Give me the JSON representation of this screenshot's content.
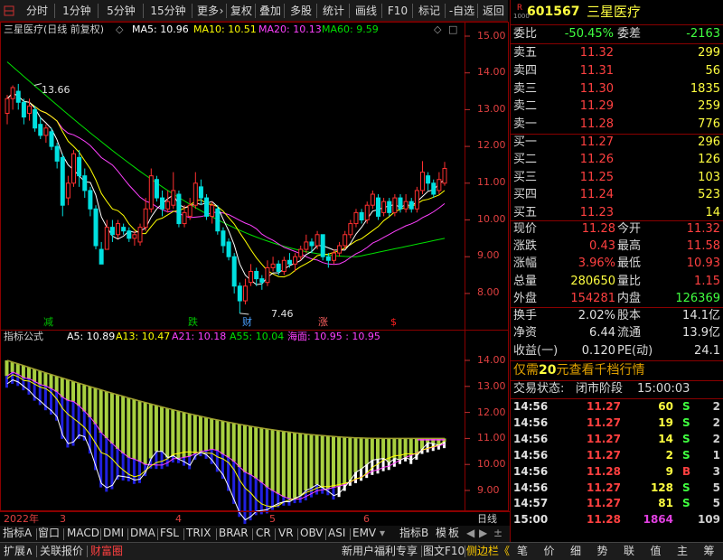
{
  "toolbar": {
    "items": [
      "分时",
      "1分钟",
      "5分钟",
      "15分钟",
      "更多",
      "复权",
      "叠加",
      "多股",
      "统计",
      "画线",
      "F10",
      "标记",
      "-自选",
      "返回"
    ],
    "more_arrow": "›"
  },
  "main_chart": {
    "title": "三星医疗(日线 前复权)",
    "ma_labels": [
      {
        "text": "MA5: 10.96",
        "color": "#ffffff"
      },
      {
        "text": "MA10: 10.51",
        "color": "#ffff00"
      },
      {
        "text": "MA20: 10.13",
        "color": "#ff40ff"
      },
      {
        "text": "MA60: 9.59",
        "color": "#00e000"
      }
    ],
    "y_ticks": [
      "15.00",
      "14.00",
      "13.00",
      "12.00",
      "11.00",
      "10.00",
      "9.00",
      "8.00"
    ],
    "high_label": "13.66",
    "low_label": "7.46",
    "markers": [
      {
        "text": "减",
        "color": "#00c000"
      },
      {
        "text": "跌",
        "color": "#00c000"
      },
      {
        "text": "财",
        "color": "#4aa0ff"
      },
      {
        "text": "涨",
        "color": "#ff6060"
      },
      {
        "text": "$",
        "color": "#ff2020"
      }
    ]
  },
  "sub_chart": {
    "name": "指标公式",
    "labels": [
      {
        "text": "A5: 10.89",
        "color": "#ffffff"
      },
      {
        "text": "A13: 10.47",
        "color": "#ffff00"
      },
      {
        "text": "A21: 10.18",
        "color": "#ff40ff"
      },
      {
        "text": "A55: 10.04",
        "color": "#00e000"
      },
      {
        "text": "海面: 10.95 : 10.95",
        "color": "#ff40ff"
      }
    ],
    "y_ticks": [
      "14.00",
      "13.00",
      "12.00",
      "11.00",
      "10.00",
      "9.00"
    ]
  },
  "time_axis": {
    "labels": [
      "2022年",
      "3",
      "4",
      "5",
      "6"
    ],
    "period": "日线"
  },
  "indicator_tabs": [
    "指标A",
    "窗口",
    "MACD",
    "DMI",
    "DMA",
    "FSL",
    "TRIX",
    "BRAR",
    "CR",
    "VR",
    "OBV",
    "ASI",
    "EMV",
    "指标B",
    "模",
    "板"
  ],
  "bottom_bar": {
    "items": [
      "扩展∧",
      "关联报价",
      "财富圈"
    ],
    "right_items": [
      "新用户福利专享",
      "图文F10",
      "侧边栏《"
    ],
    "right_tabs": [
      "笔",
      "价",
      "细",
      "势",
      "联",
      "值",
      "主",
      "筹"
    ]
  },
  "quote": {
    "code": "601567",
    "name": "三星医疗",
    "r_badge": "R",
    "wei_bi_label": "委比",
    "wei_bi": "-50.45%",
    "wei_cha_label": "委差",
    "wei_cha": "-2163",
    "asks": [
      {
        "label": "卖五",
        "price": "11.32",
        "vol": "299"
      },
      {
        "label": "卖四",
        "price": "11.31",
        "vol": "56"
      },
      {
        "label": "卖三",
        "price": "11.30",
        "vol": "1835"
      },
      {
        "label": "卖二",
        "price": "11.29",
        "vol": "259"
      },
      {
        "label": "卖一",
        "price": "11.28",
        "vol": "776"
      }
    ],
    "bids": [
      {
        "label": "买一",
        "price": "11.27",
        "vol": "296"
      },
      {
        "label": "买二",
        "price": "11.26",
        "vol": "126"
      },
      {
        "label": "买三",
        "price": "11.25",
        "vol": "103"
      },
      {
        "label": "买四",
        "price": "11.24",
        "vol": "523"
      },
      {
        "label": "买五",
        "price": "11.23",
        "vol": "14"
      }
    ],
    "stats": [
      {
        "l1": "现价",
        "v1": "11.28",
        "c1": "#ff4040",
        "l2": "今开",
        "v2": "11.32",
        "c2": "#ff4040"
      },
      {
        "l1": "涨跌",
        "v1": "0.43",
        "c1": "#ff4040",
        "l2": "最高",
        "v2": "11.58",
        "c2": "#ff4040"
      },
      {
        "l1": "涨幅",
        "v1": "3.96%",
        "c1": "#ff4040",
        "l2": "最低",
        "v2": "10.93",
        "c2": "#ff4040"
      },
      {
        "l1": "总量",
        "v1": "280650",
        "c1": "#ffff40",
        "l2": "量比",
        "v2": "1.15",
        "c2": "#ff4040"
      },
      {
        "l1": "外盘",
        "v1": "154281",
        "c1": "#ff4040",
        "l2": "内盘",
        "v2": "126369",
        "c2": "#40ff40"
      }
    ],
    "stats2": [
      {
        "l1": "换手",
        "v1": "2.02%",
        "l2": "股本",
        "v2": "14.1亿"
      },
      {
        "l1": "净资",
        "v1": "6.44",
        "l2": "流通",
        "v2": "13.9亿"
      },
      {
        "l1": "收益(一)",
        "v1": "0.120",
        "l2": "PE(动)",
        "v2": "24.1"
      }
    ],
    "promo_prefix": "仅需",
    "promo_num": "20",
    "promo_suffix": "元查看千档行情",
    "trade_status_label": "交易状态:",
    "trade_status": "闭市阶段",
    "trade_time": "15:00:03"
  },
  "trades": [
    {
      "time": "14:56",
      "price": "11.27",
      "vol": "60",
      "side": "S",
      "count": "2"
    },
    {
      "time": "14:56",
      "price": "11.27",
      "vol": "19",
      "side": "S",
      "count": "2"
    },
    {
      "time": "14:56",
      "price": "11.27",
      "vol": "14",
      "side": "S",
      "count": "2"
    },
    {
      "time": "14:56",
      "price": "11.27",
      "vol": "2",
      "side": "S",
      "count": "1"
    },
    {
      "time": "14:56",
      "price": "11.28",
      "vol": "9",
      "side": "B",
      "count": "3"
    },
    {
      "time": "14:56",
      "price": "11.27",
      "vol": "128",
      "side": "S",
      "count": "5"
    },
    {
      "time": "14:57",
      "price": "11.27",
      "vol": "81",
      "side": "S",
      "count": "5"
    },
    {
      "time": "15:00",
      "price": "11.28",
      "vol": "1864",
      "side": "",
      "count": "109"
    }
  ],
  "colors": {
    "up": "#ff3030",
    "down": "#00e0e0",
    "ma5": "#ffffff",
    "ma10": "#ffff00",
    "ma20": "#ff40ff",
    "ma60": "#00e000"
  },
  "candles": [
    [
      12.9,
      13.3,
      13.4,
      12.6
    ],
    [
      13.3,
      13.6,
      13.66,
      13.0
    ],
    [
      13.5,
      13.2,
      13.7,
      13.0
    ],
    [
      13.2,
      12.8,
      13.3,
      12.6
    ],
    [
      12.9,
      13.1,
      13.3,
      12.7
    ],
    [
      13.0,
      12.5,
      13.1,
      12.4
    ],
    [
      12.6,
      12.3,
      12.8,
      12.2
    ],
    [
      12.3,
      12.5,
      12.6,
      12.1
    ],
    [
      12.4,
      12.0,
      12.5,
      11.9
    ],
    [
      12.0,
      11.6,
      12.1,
      11.4
    ],
    [
      11.7,
      10.4,
      11.8,
      10.1
    ],
    [
      10.6,
      11.0,
      11.2,
      10.4
    ],
    [
      11.0,
      11.8,
      11.9,
      10.9
    ],
    [
      11.7,
      11.2,
      11.9,
      10.9
    ],
    [
      11.2,
      10.8,
      11.4,
      10.6
    ],
    [
      10.8,
      10.3,
      10.9,
      10.1
    ],
    [
      10.3,
      9.3,
      10.4,
      9.2
    ],
    [
      9.2,
      8.8,
      9.4,
      8.8
    ],
    [
      9.2,
      9.8,
      10.0,
      9.2
    ],
    [
      9.8,
      9.6,
      10.0,
      9.4
    ],
    [
      9.6,
      9.9,
      10.0,
      9.5
    ],
    [
      9.8,
      9.7,
      9.9,
      9.6
    ],
    [
      9.7,
      9.5,
      9.8,
      9.4
    ],
    [
      9.5,
      9.6,
      9.7,
      9.3
    ],
    [
      9.4,
      9.8,
      9.9,
      9.3
    ],
    [
      9.8,
      10.3,
      10.6,
      9.7
    ],
    [
      10.3,
      11.2,
      11.4,
      10.2
    ],
    [
      11.1,
      10.6,
      11.2,
      10.5
    ],
    [
      10.6,
      10.3,
      10.8,
      10.1
    ],
    [
      10.3,
      10.5,
      10.8,
      10.2
    ],
    [
      10.4,
      10.8,
      11.3,
      10.3
    ],
    [
      10.7,
      9.9,
      10.8,
      9.8
    ],
    [
      9.9,
      10.2,
      10.4,
      9.8
    ],
    [
      10.1,
      10.4,
      10.6,
      10.0
    ],
    [
      10.4,
      11.0,
      11.3,
      10.3
    ],
    [
      10.9,
      10.6,
      11.1,
      10.4
    ],
    [
      10.6,
      10.1,
      10.7,
      10.0
    ],
    [
      10.1,
      10.4,
      10.5,
      9.9
    ],
    [
      10.3,
      9.7,
      10.4,
      9.6
    ],
    [
      9.7,
      9.3,
      9.8,
      9.1
    ],
    [
      9.4,
      9.0,
      9.5,
      8.9
    ],
    [
      9.0,
      8.2,
      9.1,
      8.0
    ],
    [
      8.2,
      7.8,
      8.3,
      7.46
    ],
    [
      7.8,
      8.2,
      8.4,
      7.7
    ],
    [
      8.3,
      8.6,
      8.8,
      8.2
    ],
    [
      8.6,
      8.4,
      8.7,
      8.2
    ],
    [
      8.4,
      8.3,
      8.5,
      8.1
    ],
    [
      8.3,
      8.7,
      8.9,
      8.2
    ],
    [
      8.7,
      8.8,
      9.0,
      8.6
    ],
    [
      8.8,
      8.6,
      8.9,
      8.5
    ],
    [
      8.6,
      8.9,
      9.0,
      8.5
    ],
    [
      8.9,
      8.8,
      9.1,
      8.7
    ],
    [
      8.8,
      9.0,
      9.1,
      8.6
    ],
    [
      9.0,
      9.2,
      9.3,
      8.9
    ],
    [
      9.2,
      9.4,
      9.6,
      9.1
    ],
    [
      9.4,
      9.3,
      9.5,
      9.1
    ],
    [
      9.3,
      9.6,
      9.7,
      9.2
    ],
    [
      9.6,
      9.0,
      9.6,
      8.9
    ],
    [
      9.0,
      8.9,
      9.1,
      8.7
    ],
    [
      8.9,
      9.1,
      9.2,
      8.8
    ],
    [
      9.1,
      9.3,
      9.4,
      9.0
    ],
    [
      9.3,
      9.6,
      9.7,
      9.2
    ],
    [
      9.6,
      9.9,
      10.0,
      9.5
    ],
    [
      9.9,
      10.2,
      10.3,
      9.8
    ],
    [
      10.2,
      10.0,
      10.3,
      9.9
    ],
    [
      10.0,
      10.4,
      10.5,
      9.9
    ],
    [
      10.4,
      10.7,
      10.8,
      10.3
    ],
    [
      10.6,
      10.1,
      10.7,
      10.0
    ],
    [
      10.2,
      10.5,
      10.6,
      10.1
    ],
    [
      10.5,
      10.2,
      10.6,
      10.1
    ],
    [
      10.2,
      10.6,
      10.7,
      10.1
    ],
    [
      10.6,
      10.3,
      10.7,
      10.2
    ],
    [
      10.3,
      10.5,
      10.7,
      10.2
    ],
    [
      10.5,
      10.3,
      10.6,
      10.2
    ],
    [
      10.3,
      10.8,
      10.9,
      10.2
    ],
    [
      10.8,
      11.3,
      11.6,
      10.7
    ],
    [
      11.2,
      11.0,
      11.3,
      10.8
    ],
    [
      11.0,
      10.7,
      11.1,
      10.6
    ],
    [
      10.8,
      11.1,
      11.3,
      10.7
    ],
    [
      11.0,
      11.4,
      11.58,
      10.93
    ]
  ]
}
